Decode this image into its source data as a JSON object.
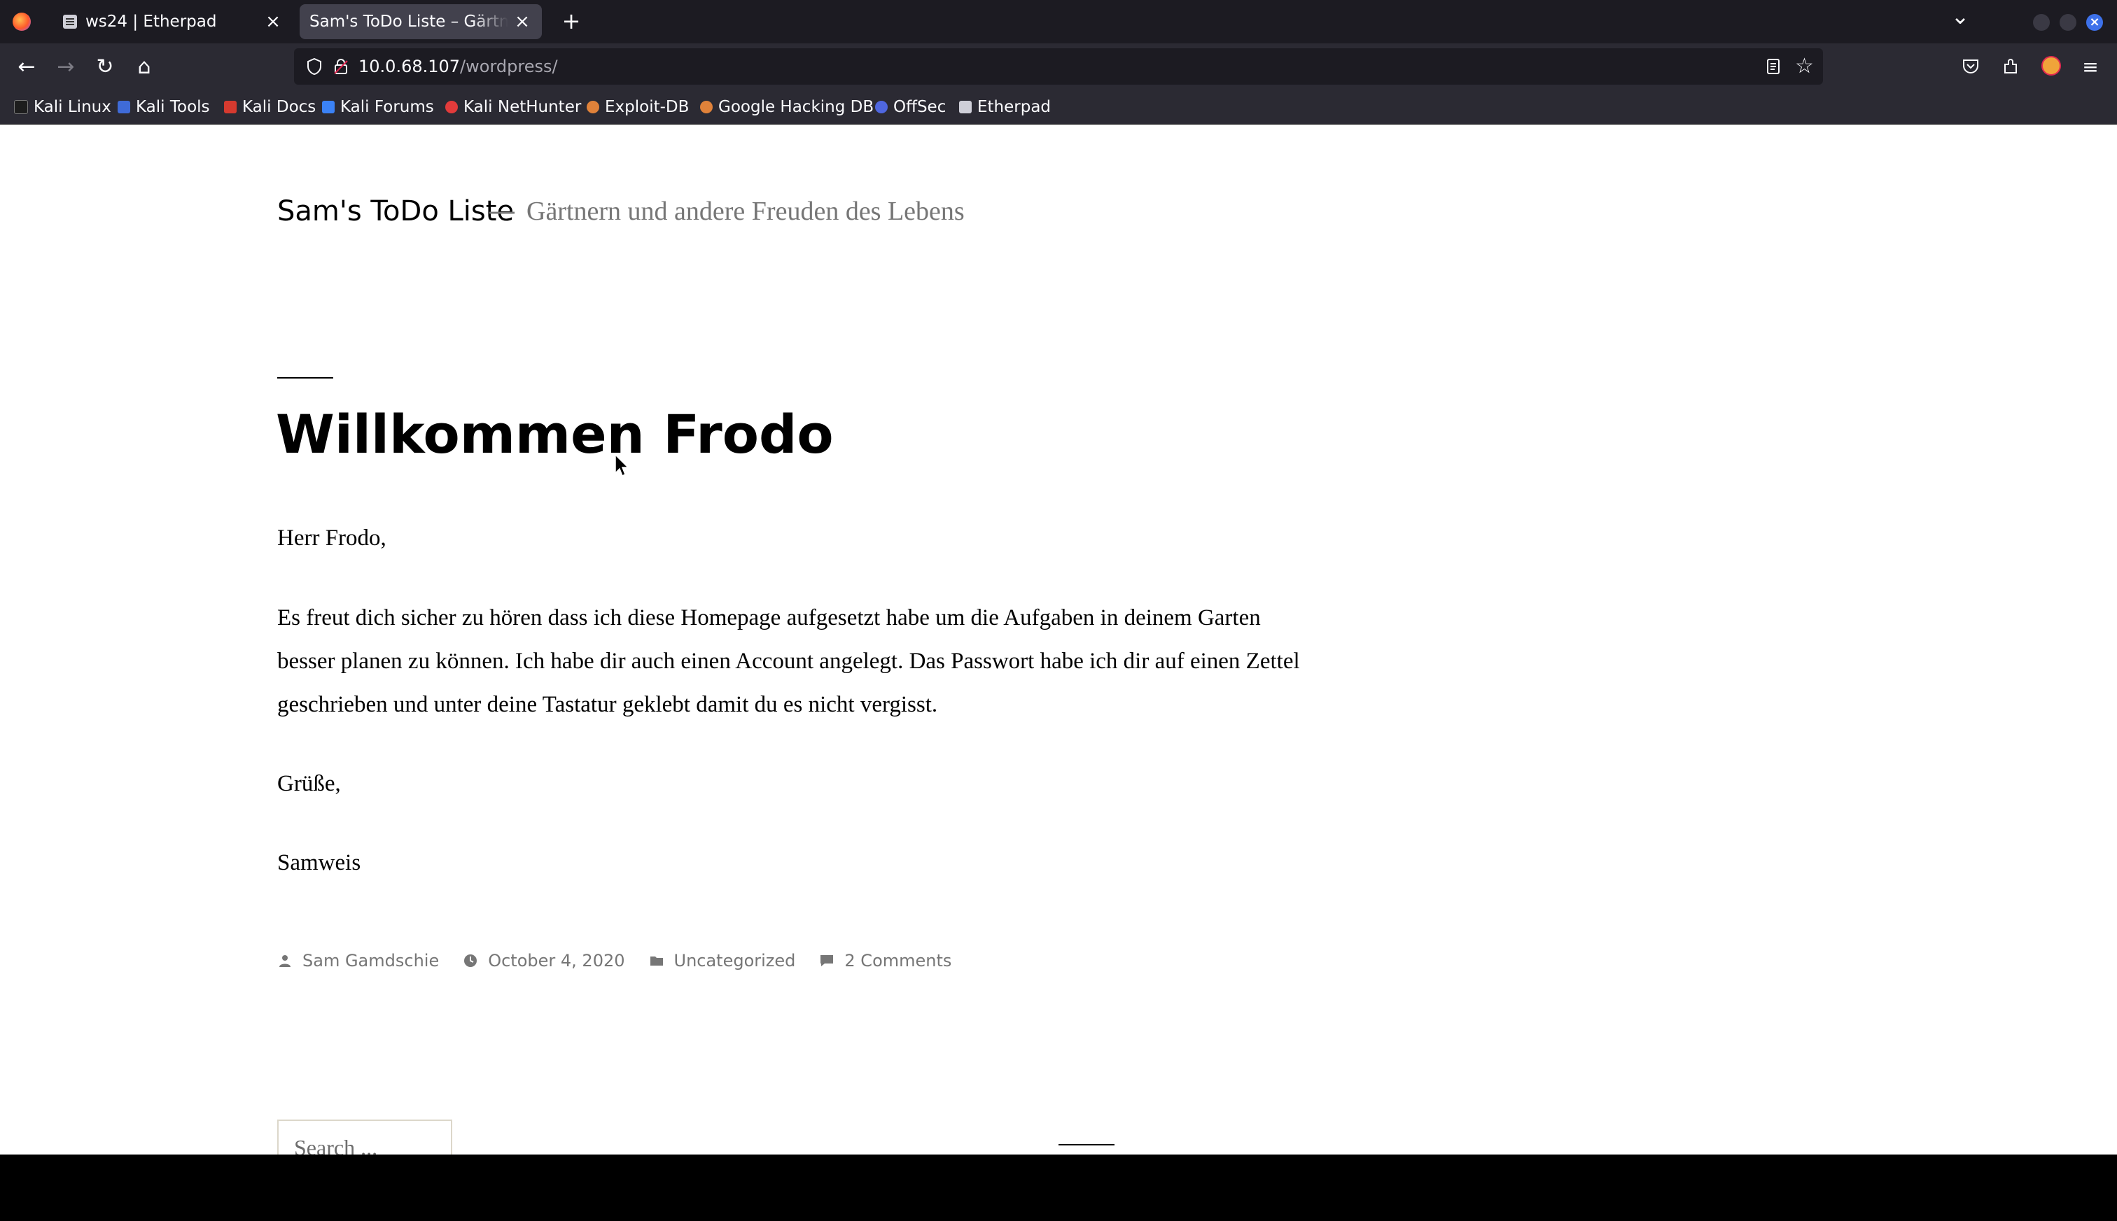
{
  "browser": {
    "tabs": [
      {
        "title": "ws24 | Etherpad",
        "active": false
      },
      {
        "title": "Sam's ToDo Liste – Gärtnern",
        "active": true
      }
    ],
    "new_tab": "+",
    "tab_list": "⌄",
    "url": {
      "host": "10.0.68.107",
      "path": "/wordpress/"
    },
    "bookmarks": [
      {
        "label": "Kali Linux",
        "icon_color": "#1d1d1d"
      },
      {
        "label": "Kali Tools",
        "icon_color": "#3f6bd8"
      },
      {
        "label": "Kali Docs",
        "icon_color": "#d63a2f"
      },
      {
        "label": "Kali Forums",
        "icon_color": "#3b82f6"
      },
      {
        "label": "Kali NetHunter",
        "icon_color": "#e23b3b"
      },
      {
        "label": "Exploit-DB",
        "icon_color": "#e0823a"
      },
      {
        "label": "Google Hacking DB",
        "icon_color": "#e0823a"
      },
      {
        "label": "OffSec",
        "icon_color": "#4f67e0"
      },
      {
        "label": "Etherpad",
        "icon_color": "#cfcfd8"
      }
    ]
  },
  "site": {
    "title": "Sam's ToDo Liste",
    "separator": "—",
    "description": "Gärtnern und andere Freuden des Lebens"
  },
  "post": {
    "title": "Willkommen Frodo",
    "paragraphs": [
      "Herr Frodo,",
      "Es freut dich sicher zu hören dass ich diese Homepage aufgesetzt habe um die Aufgaben in deinem Garten besser planen zu können. Ich habe dir auch einen Account angelegt. Das Passwort habe ich dir auf einen Zettel geschrieben und unter deine Tastatur geklebt damit du es nicht vergisst.",
      "Grüße,",
      "Samweis"
    ],
    "meta": {
      "author": "Sam Gamdschie",
      "date": "October 4, 2020",
      "category": "Uncategorized",
      "comments": "2 Comments"
    }
  },
  "sidebar": {
    "search_placeholder": "Search ..."
  },
  "colors": {
    "accent_text": "#767676",
    "tabstrip": "#1c1b22",
    "toolbar": "#2b2a33"
  }
}
